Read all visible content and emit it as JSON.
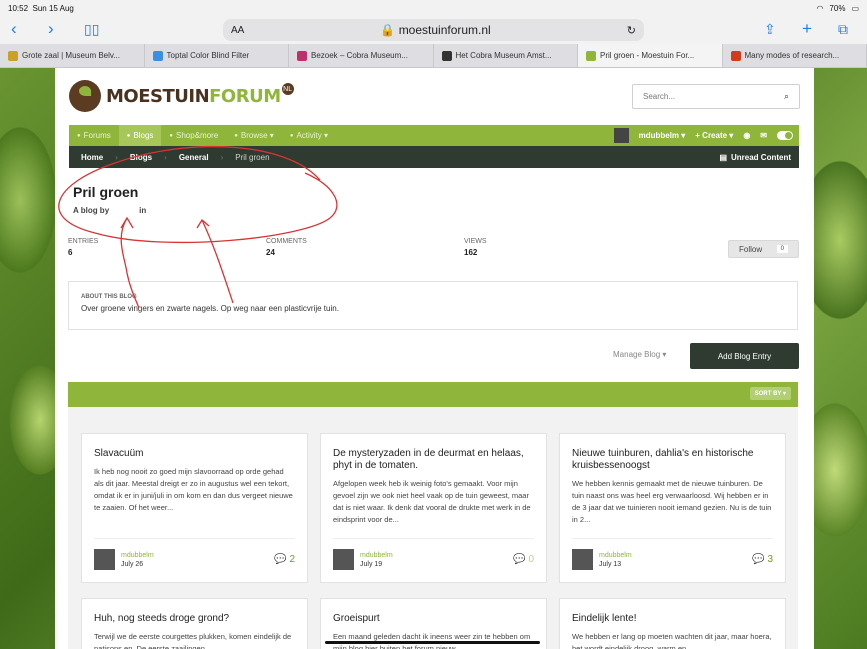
{
  "status": {
    "time": "10:52",
    "date": "Sun 15 Aug",
    "battery": "70%"
  },
  "browser": {
    "url": "moestuinforum.nl",
    "aa_label": "AA",
    "tabs": [
      {
        "label": "Grote zaal | Museum Belv...",
        "color": "#c9a227"
      },
      {
        "label": "Toptal Color Blind Filter",
        "color": "#3a8ee6"
      },
      {
        "label": "Bezoek – Cobra Museum...",
        "color": "#c0306a"
      },
      {
        "label": "Het Cobra Museum Amst...",
        "color": "#333333"
      },
      {
        "label": "Pril groen - Moestuin For...",
        "color": "#8fb63a",
        "active": true
      },
      {
        "label": "Many modes of research...",
        "color": "#d23a1a"
      }
    ]
  },
  "site": {
    "logo_main": "MOESTUIN",
    "logo_accent": "FORUM",
    "logo_badge": "NL",
    "search_placeholder": "Search...",
    "nav": [
      {
        "label": "Forums",
        "icon": "chat-icon"
      },
      {
        "label": "Blogs",
        "icon": "pencil-icon",
        "active": true
      },
      {
        "label": "Shop&more",
        "icon": "cart-icon"
      },
      {
        "label": "Browse ▾",
        "icon": "list-icon"
      },
      {
        "label": "Activity ▾",
        "icon": "pulse-icon"
      }
    ],
    "user": "mdubbelm ▾",
    "create": "+ Create ▾",
    "breadcrumbs": [
      "Home",
      "Blogs",
      "General",
      "Pril groen"
    ],
    "unread": "Unread Content"
  },
  "blog": {
    "title": "Pril groen",
    "by_label": "A blog by",
    "in_label": "in",
    "stats": [
      {
        "label": "ENTRIES",
        "value": "6"
      },
      {
        "label": "COMMENTS",
        "value": "24"
      },
      {
        "label": "VIEWS",
        "value": "162"
      }
    ],
    "follow_label": "Follow",
    "follow_count": "0",
    "about_heading": "ABOUT THIS BLOG",
    "about_text": "Over groene vingers en zwarte nagels. Op weg naar een plasticvrije tuin.",
    "manage_label": "Manage Blog ▾",
    "add_entry_label": "Add Blog Entry",
    "sort_label": "SORT BY ▾"
  },
  "entries": [
    {
      "title": "Slavacuüm",
      "excerpt": "Ik heb nog nooit zo goed mijn slavoorraad op orde gehad als dit jaar. Meestal dreigt er zo in augustus wel een tekort, omdat ik er in juni/juli in om kom en dan dus vergeet nieuwe te zaaien. Of het weer...",
      "author": "mdubbelm",
      "date": "July 26",
      "comments": "2"
    },
    {
      "title": "De mysteryzaden in de deurmat en helaas, phyt in de tomaten.",
      "excerpt": "Afgelopen week heb ik weinig foto's gemaakt. Voor mijn gevoel zijn we ook niet heel vaak op de tuin geweest, maar dat is niet waar. Ik denk dat vooral de drukte met werk in de eindsprint voor de...",
      "author": "mdubbelm",
      "date": "July 19",
      "comments": "0"
    },
    {
      "title": "Nieuwe tuinburen, dahlia's en historische kruisbessenoogst",
      "excerpt": "We hebben kennis gemaakt met de nieuwe tuinburen. De tuin naast ons was heel erg verwaarloosd. Wij hebben er in de 3 jaar dat we tuinieren nooit iemand gezien. Nu is de tuin in 2...",
      "author": "mdubbelm",
      "date": "July 13",
      "comments": "3"
    },
    {
      "title": "Huh, nog steeds droge grond?",
      "excerpt": "Terwijl we de eerste courgettes plukken, komen eindelijk de patisons en. De eerste zaailingen",
      "author": "",
      "date": "",
      "comments": ""
    },
    {
      "title": "Groeispurt",
      "excerpt": "Een maand geleden dacht ik ineens weer zin te hebben om mijn blog hier buiten het forum nieuw",
      "author": "",
      "date": "",
      "comments": ""
    },
    {
      "title": "Eindelijk lente!",
      "excerpt": "We hebben er lang op moeten wachten dit jaar, maar hoera, het wordt eindelijk droog, warm en",
      "author": "",
      "date": "",
      "comments": ""
    }
  ]
}
